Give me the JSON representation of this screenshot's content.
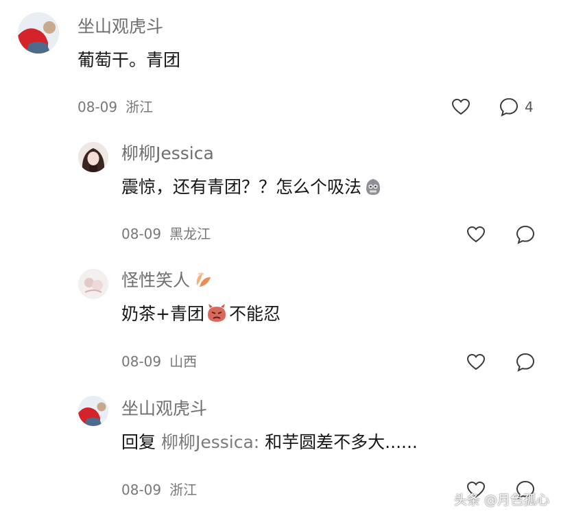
{
  "comments": [
    {
      "author": "坐山观虎斗",
      "text": "葡萄干。青团",
      "date": "08-09",
      "location": "浙江",
      "reply_count": "4",
      "icons": [
        "heart-icon",
        "comment-icon"
      ]
    },
    {
      "author": "柳柳Jessica",
      "text": "震惊，还有青团？？怎么个吸法",
      "text_emoji": "grimace-emoji",
      "date": "08-09",
      "location": "黑龙江",
      "icons": [
        "heart-icon",
        "comment-icon"
      ]
    },
    {
      "author": "怪性笑人",
      "author_badge": "leaf-badge-icon",
      "text_before": "奶茶+青团",
      "text_emoji": "angry-emoji",
      "text_after": "不能忍",
      "date": "08-09",
      "location": "山西",
      "icons": [
        "heart-icon",
        "comment-icon"
      ]
    },
    {
      "author": "坐山观虎斗",
      "reply_prefix": "回复",
      "reply_to": "柳柳Jessica:",
      "text": "和芋圆差不多大......",
      "date": "08-09",
      "location": "浙江",
      "icons": [
        "heart-icon",
        "comment-icon"
      ]
    }
  ],
  "watermark": "头条 @月色孤心",
  "colors": {
    "background": "#ffffff",
    "name": "#6e6e6e",
    "text": "#161616",
    "meta": "#777777",
    "icon_stroke": "#3a3a3a"
  }
}
